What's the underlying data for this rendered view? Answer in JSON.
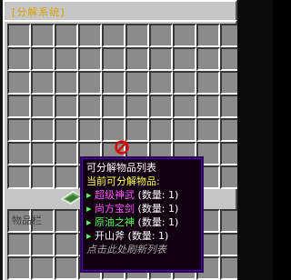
{
  "window": {
    "title": "[分解系统]",
    "inventory_label": "物品栏"
  },
  "colors": {
    "panel": "#c6c6c6",
    "slot": "#8b8b8b",
    "tooltip_bg": "#100010",
    "tooltip_border": "#5000b0",
    "title_color": "#d8a000"
  },
  "grid": {
    "upper_rows": 7,
    "columns": 10,
    "lower_rows": 3
  },
  "slots": {
    "blocked_slot_icon": "no-entry-icon",
    "inventory_item_icon": "banknote-icon"
  },
  "tooltip": {
    "title": "可分解物品列表",
    "subtitle": "当前可分解物品:",
    "items": [
      {
        "bullet": "▸",
        "name": "超级神武",
        "qty": "(数量: 1)",
        "color": "#ff55ff"
      },
      {
        "bullet": "▸",
        "name": "尚方宝剑",
        "qty": "(数量: 1)",
        "color": "#ff55ff"
      },
      {
        "bullet": "▸",
        "name": "原油之神",
        "qty": "(数量: 1)",
        "color": "#55ff55"
      },
      {
        "bullet": "▸",
        "name": "开山斧",
        "qty": "(数量: 1)",
        "color": "#ffffff"
      }
    ],
    "footer": "点击此处刷新列表"
  }
}
